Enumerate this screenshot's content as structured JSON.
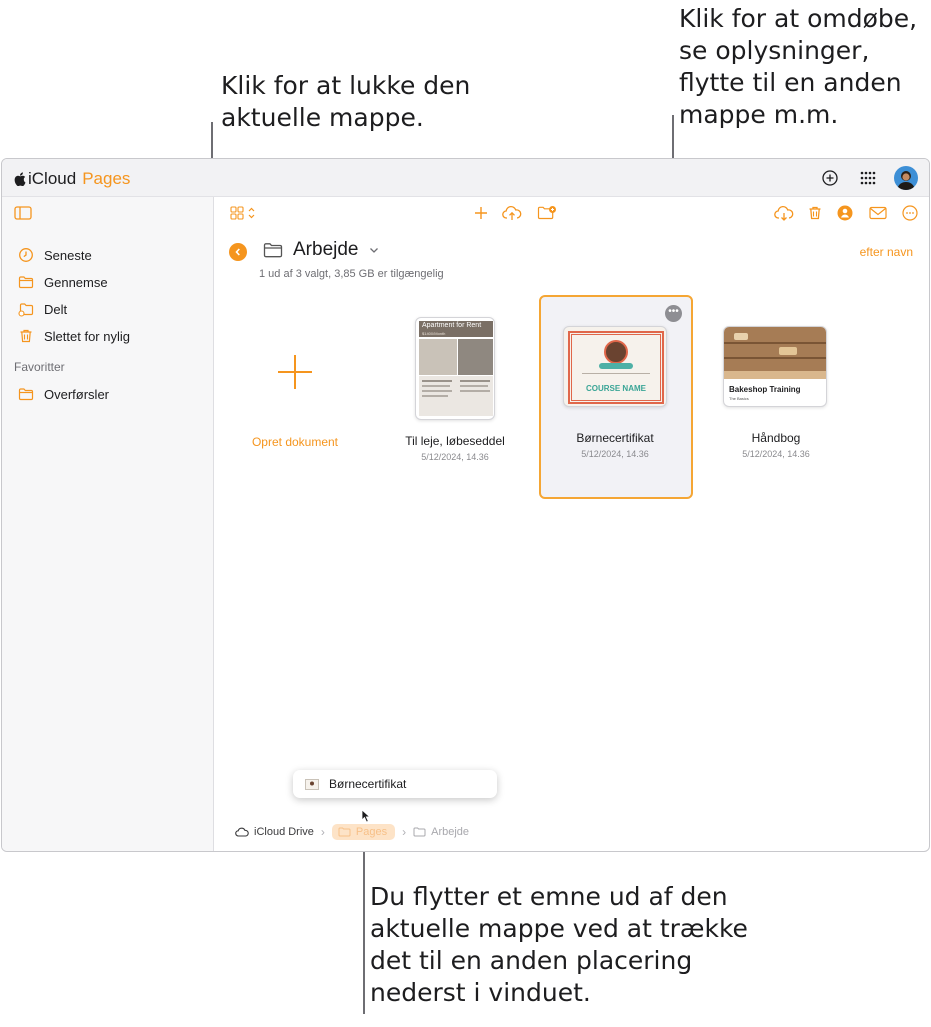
{
  "callouts": {
    "close_folder": [
      "Klik for at lukke den",
      "aktuelle mappe."
    ],
    "rename": [
      "Klik for at omdøbe,",
      "se oplysninger,",
      "flytte til en anden",
      "mappe m.m."
    ],
    "drag": [
      "Du flytter et emne ud af den",
      "aktuelle mappe ved at trække",
      "det til en anden placering",
      "nederst i vinduet."
    ]
  },
  "app": {
    "brand_icloud": "iCloud",
    "brand_pages": "Pages"
  },
  "sidebar": {
    "items": [
      {
        "label": "Seneste",
        "icon": "clock-icon"
      },
      {
        "label": "Gennemse",
        "icon": "folder-icon"
      },
      {
        "label": "Delt",
        "icon": "shared-folder-icon"
      },
      {
        "label": "Slettet for nylig",
        "icon": "trash-icon"
      }
    ],
    "favorites_heading": "Favoritter",
    "favorites": [
      {
        "label": "Overførsler",
        "icon": "folder-icon"
      }
    ]
  },
  "main": {
    "folder_title": "Arbejde",
    "status": "1 ud af 3 valgt, 3,85 GB er tilgængelig",
    "sort_label": "efter navn",
    "create_label": "Opret dokument",
    "documents": [
      {
        "name": "Til leje, løbeseddel",
        "date": "5/12/2024, 14.36",
        "thumb_title": "Apartment for Rent",
        "thumb_sub": "$1400/Month"
      },
      {
        "name": "Børnecertifikat",
        "date": "5/12/2024, 14.36",
        "thumb_title": "COURSE NAME"
      },
      {
        "name": "Håndbog",
        "date": "5/12/2024, 14.36",
        "thumb_title": "Bakeshop Training",
        "thumb_sub": "The Basics"
      }
    ]
  },
  "drag": {
    "chip_label": "Børnecertifikat"
  },
  "breadcrumbs": [
    {
      "label": "iCloud Drive"
    },
    {
      "label": "Pages"
    },
    {
      "label": "Arbejde"
    }
  ],
  "colors": {
    "accent": "#f5951e",
    "selection_border": "#f5a634"
  }
}
